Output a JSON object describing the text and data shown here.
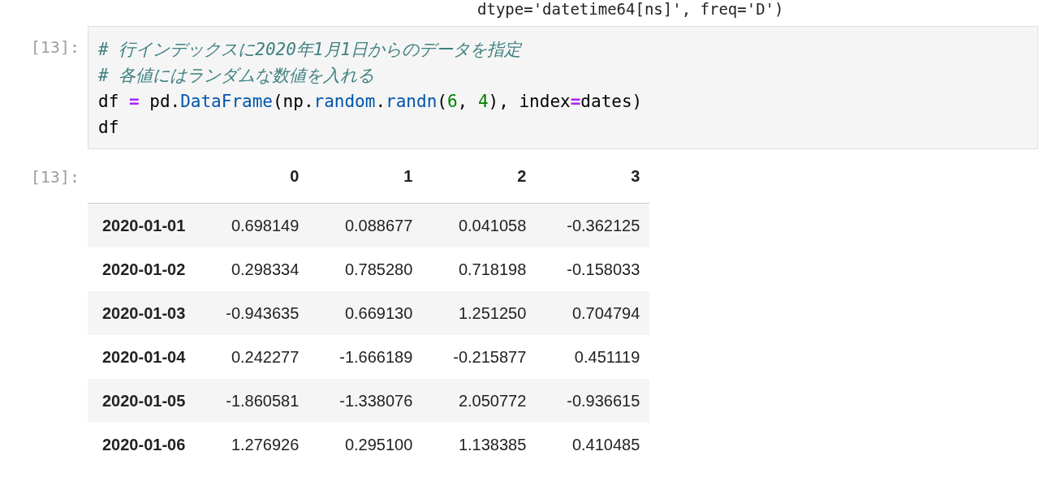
{
  "previous_output": "dtype='datetime64[ns]', freq='D')",
  "input_cell": {
    "prompt": "[13]:",
    "lines": [
      [
        {
          "kind": "comment",
          "text": "# 行インデックスに2020年1月1日からのデータを指定"
        }
      ],
      [
        {
          "kind": "comment",
          "text": "# 各値にはランダムな数値を入れる"
        }
      ],
      [
        {
          "kind": "plain",
          "text": "df "
        },
        {
          "kind": "operator",
          "text": "="
        },
        {
          "kind": "plain",
          "text": " pd."
        },
        {
          "kind": "name",
          "text": "DataFrame"
        },
        {
          "kind": "plain",
          "text": "(np."
        },
        {
          "kind": "name",
          "text": "random"
        },
        {
          "kind": "plain",
          "text": "."
        },
        {
          "kind": "name",
          "text": "randn"
        },
        {
          "kind": "plain",
          "text": "("
        },
        {
          "kind": "number",
          "text": "6"
        },
        {
          "kind": "plain",
          "text": ", "
        },
        {
          "kind": "number",
          "text": "4"
        },
        {
          "kind": "plain",
          "text": "), index"
        },
        {
          "kind": "operator",
          "text": "="
        },
        {
          "kind": "plain",
          "text": "dates)"
        }
      ],
      [
        {
          "kind": "plain",
          "text": "df"
        }
      ]
    ]
  },
  "output_cell": {
    "prompt": "[13]:",
    "table": {
      "columns": [
        "",
        "0",
        "1",
        "2",
        "3"
      ],
      "rows": [
        [
          "2020-01-01",
          "0.698149",
          "0.088677",
          "0.041058",
          "-0.362125"
        ],
        [
          "2020-01-02",
          "0.298334",
          "0.785280",
          "0.718198",
          "-0.158033"
        ],
        [
          "2020-01-03",
          "-0.943635",
          "0.669130",
          "1.251250",
          "0.704794"
        ],
        [
          "2020-01-04",
          "0.242277",
          "-1.666189",
          "-0.215877",
          "0.451119"
        ],
        [
          "2020-01-05",
          "-1.860581",
          "-1.338076",
          "2.050772",
          "-0.936615"
        ],
        [
          "2020-01-06",
          "1.276926",
          "0.295100",
          "1.138385",
          "0.410485"
        ]
      ]
    }
  }
}
